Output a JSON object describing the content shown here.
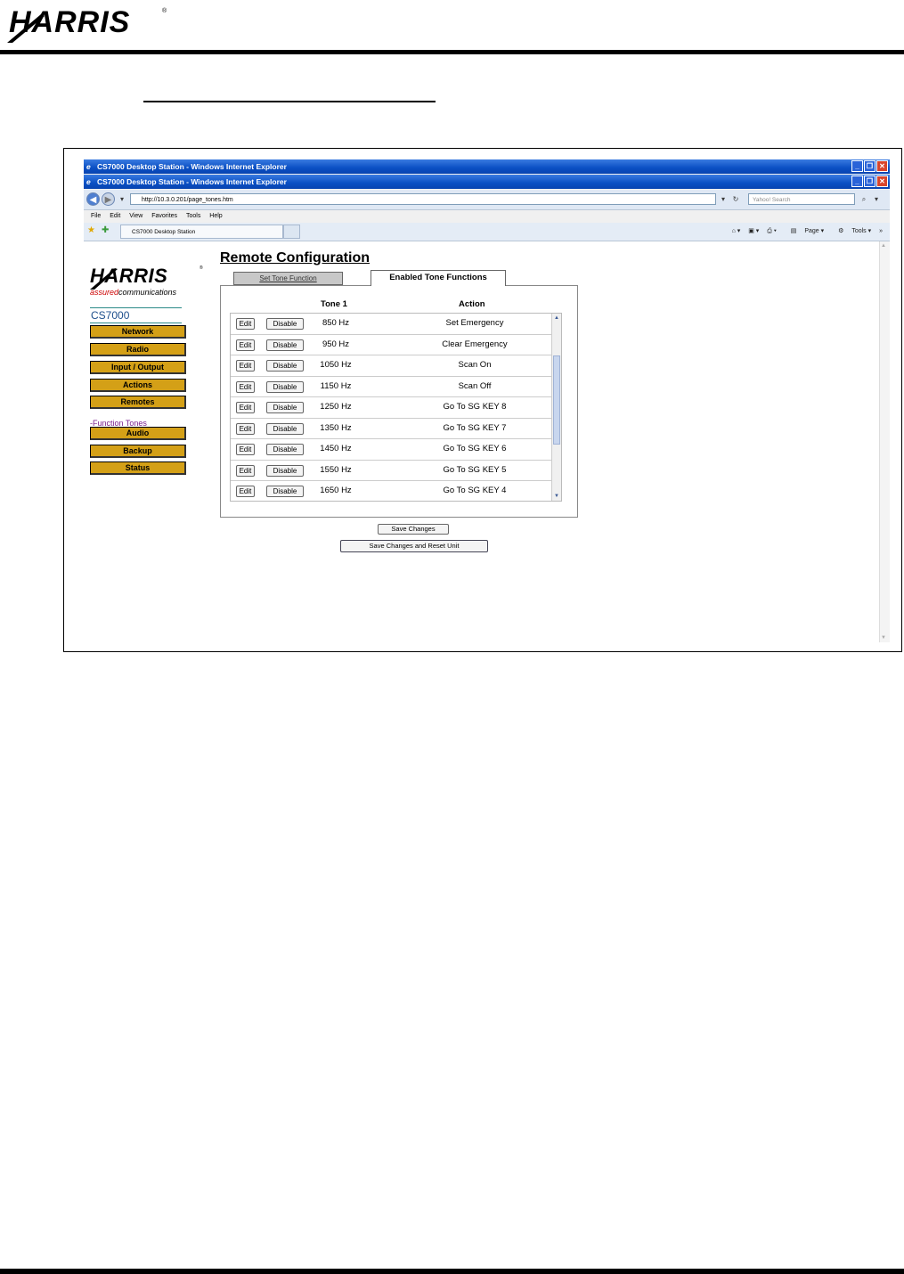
{
  "document": {
    "logo_text": "HARRIS"
  },
  "browser": {
    "window_title_1": "CS7000 Desktop Station - Windows Internet Explorer",
    "window_title_2": "CS7000 Desktop Station - Windows Internet Explorer",
    "url": "http://10.3.0.201/page_tones.htm",
    "search_placeholder": "Yahoo! Search",
    "menu": [
      "File",
      "Edit",
      "View",
      "Favorites",
      "Tools",
      "Help"
    ],
    "tab_label": "CS7000 Desktop Station",
    "command_bar": {
      "page_label": "Page",
      "tools_label": "Tools"
    },
    "icons": [
      "back-icon",
      "forward-icon",
      "refresh-icon",
      "stop-icon",
      "search-icon",
      "favorites-star-icon",
      "home-icon",
      "feeds-icon",
      "print-icon",
      "page-icon",
      "tools-icon"
    ]
  },
  "sidebar": {
    "logo_text": "HARRIS",
    "tagline_assured": "assured",
    "tagline_comms": "communications",
    "model": "CS7000",
    "nav": [
      "Network",
      "Radio",
      "Input / Output",
      "Actions",
      "Remotes",
      "Audio",
      "Backup",
      "Status"
    ],
    "sub_prefix": "-",
    "sub_link": "Function Tones"
  },
  "main": {
    "title": "Remote Configuration",
    "tab_inactive": "Set Tone Function",
    "tab_active": "Enabled Tone Functions",
    "col_tone": "Tone 1",
    "col_action": "Action",
    "edit_label": "Edit",
    "disable_label": "Disable",
    "rows": [
      {
        "tone": "850 Hz",
        "action": "Set Emergency"
      },
      {
        "tone": "950 Hz",
        "action": "Clear Emergency"
      },
      {
        "tone": "1050 Hz",
        "action": "Scan On"
      },
      {
        "tone": "1150 Hz",
        "action": "Scan Off"
      },
      {
        "tone": "1250 Hz",
        "action": "Go To SG KEY 8"
      },
      {
        "tone": "1350 Hz",
        "action": "Go To SG KEY 7"
      },
      {
        "tone": "1450 Hz",
        "action": "Go To SG KEY 6"
      },
      {
        "tone": "1550 Hz",
        "action": "Go To SG KEY 5"
      },
      {
        "tone": "1650 Hz",
        "action": "Go To SG KEY 4"
      }
    ],
    "save_label": "Save Changes",
    "save_reset_label": "Save Changes and Reset Unit"
  },
  "colors": {
    "nav_button": "#d4a017",
    "titlebar": "#0a4fc4",
    "link": "#7a1f8c",
    "model_text": "#1e4f8c"
  }
}
